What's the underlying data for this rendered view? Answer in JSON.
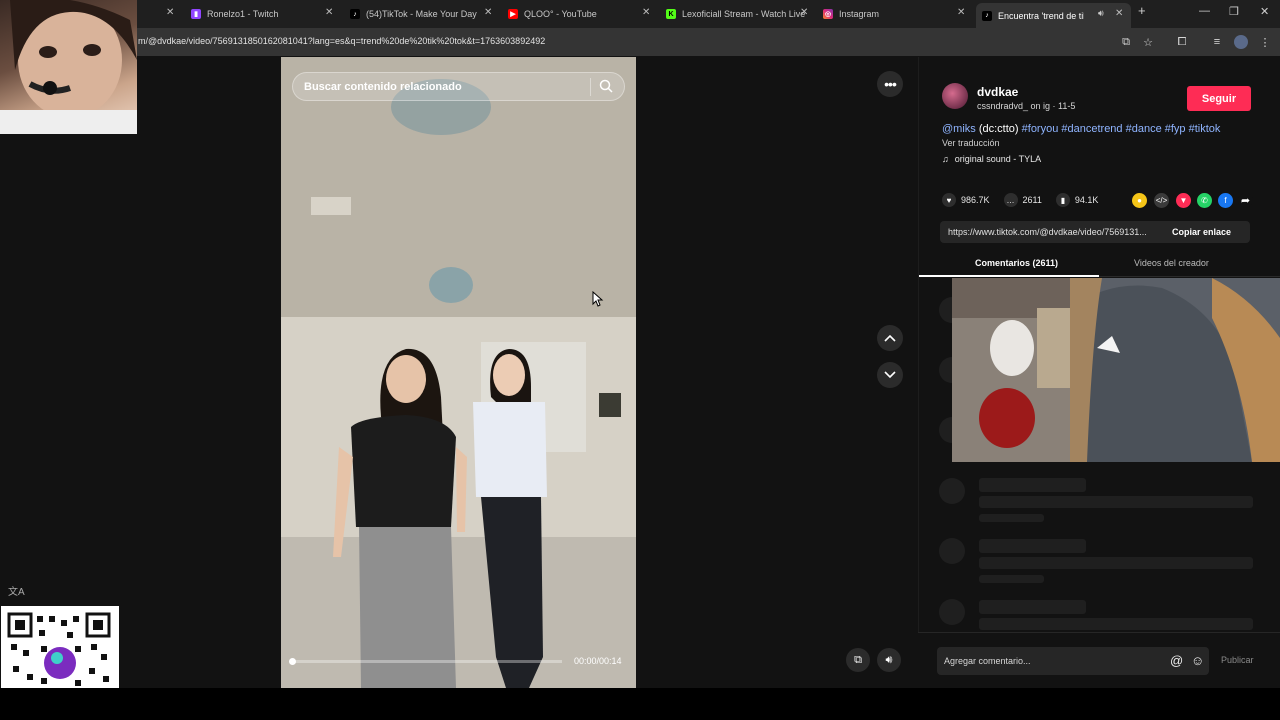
{
  "browser": {
    "tabs": [
      {
        "title": "",
        "icon": ""
      },
      {
        "title": "Ronelzo1 - Twitch",
        "icon": "twitch-icon"
      },
      {
        "title": "(54)TikTok - Make Your Day",
        "icon": "tiktok-icon"
      },
      {
        "title": "QLOO° - YouTube",
        "icon": "youtube-icon"
      },
      {
        "title": "Lexoficiall Stream - Watch Live",
        "icon": "kick-icon"
      },
      {
        "title": "Instagram",
        "icon": "instagram-icon"
      },
      {
        "title": "Encuentra 'trend de tik tok",
        "icon": "tiktok-icon",
        "active": true
      }
    ],
    "url": "m/@dvdkae/video/7569131850162081041?lang=es&q=trend%20de%20tik%20tok&t=1763603892492"
  },
  "video": {
    "search_placeholder": "Buscar contenido relacionado",
    "time": "00:00/00:14",
    "progress_fraction": 0.0
  },
  "author": {
    "username": "dvdkae",
    "subline": "cssndradvd_ on ig · 11-5",
    "follow_label": "Seguir"
  },
  "caption": {
    "mention": "@miks",
    "credit": "(dc:ctto)",
    "hashtags": "#foryou #dancetrend #dance #fyp #tiktok",
    "translate_label": "Ver traducción",
    "music": "original sound - TYLA"
  },
  "stats": {
    "likes": "986.7K",
    "comments": "2611",
    "saves": "94.1K"
  },
  "share_colors": [
    "#f5c518",
    "#3a3a3a",
    "#fe2c55",
    "#25d366",
    "#1877f2",
    "#121212"
  ],
  "link": {
    "url": "https://www.tiktok.com/@dvdkae/video/7569131...",
    "copy_label": "Copiar enlace"
  },
  "panel_tabs": {
    "comments": "Comentarios (2611)",
    "creator_videos": "Videos del creador"
  },
  "comment_bar": {
    "placeholder": "Agregar comentario...",
    "publish_label": "Publicar"
  }
}
